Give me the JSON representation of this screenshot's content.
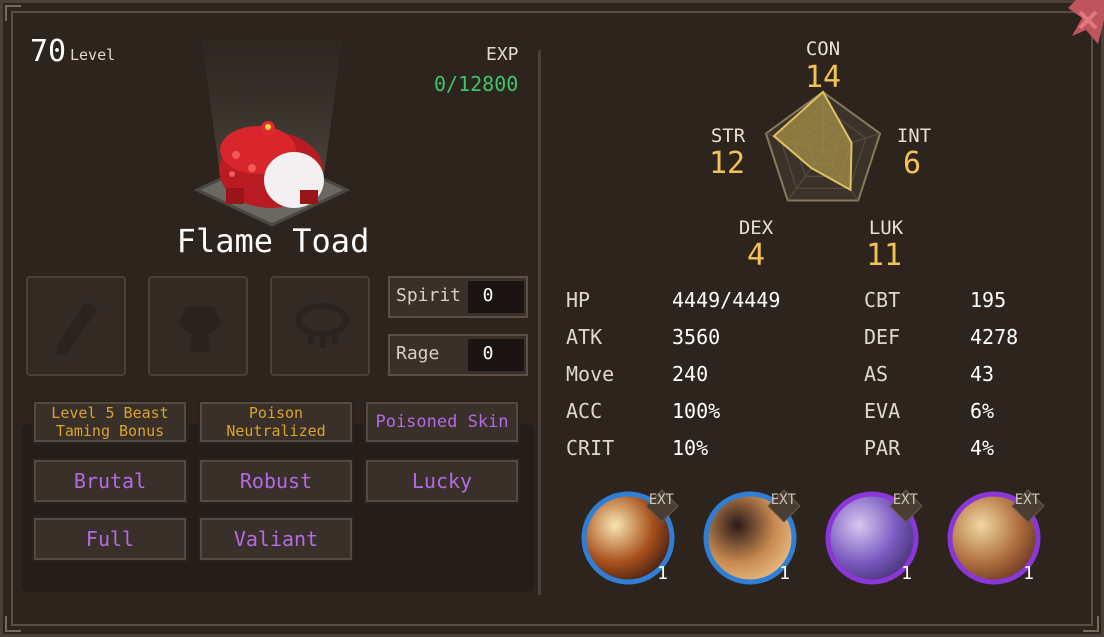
{
  "level": {
    "value": "70",
    "label": "Level"
  },
  "exp": {
    "label": "EXP",
    "value": "0/12800"
  },
  "pet": {
    "name": "Flame Toad"
  },
  "gauges": [
    {
      "label": "Spirit",
      "value": "0"
    },
    {
      "label": "Rage",
      "value": "0"
    }
  ],
  "equipment": [
    "weapon-slot",
    "armor-slot",
    "necklace-slot"
  ],
  "traits": {
    "special": [
      "Level 5 Beast",
      "Taming Bonus",
      "Poison",
      "Neutralized",
      "Poisoned Skin"
    ],
    "rows": [
      "Brutal",
      "Robust",
      "Lucky",
      "Full",
      "Valiant"
    ]
  },
  "radar": {
    "CON": {
      "label": "CON",
      "value": "14"
    },
    "STR": {
      "label": "STR",
      "value": "12"
    },
    "INT": {
      "label": "INT",
      "value": "6"
    },
    "DEX": {
      "label": "DEX",
      "value": "4"
    },
    "LUK": {
      "label": "LUK",
      "value": "11"
    },
    "fill_fractions": {
      "CON": 1.0,
      "INT": 0.5,
      "LUK": 0.78,
      "DEX": 0.33,
      "STR": 0.86
    }
  },
  "stats": {
    "left": [
      {
        "name": "HP",
        "value": "4449/4449"
      },
      {
        "name": "ATK",
        "value": "3560"
      },
      {
        "name": "Move",
        "value": "240"
      },
      {
        "name": "ACC",
        "value": "100%"
      },
      {
        "name": "CRIT",
        "value": "10%"
      }
    ],
    "right": [
      {
        "name": "CBT",
        "value": "195"
      },
      {
        "name": "DEF",
        "value": "4278"
      },
      {
        "name": "AS",
        "value": "43"
      },
      {
        "name": "EVA",
        "value": "6%"
      },
      {
        "name": "PAR",
        "value": "4%"
      }
    ]
  },
  "skills": [
    {
      "tag": "EXT",
      "level": "1",
      "ring_color": "#2f7fd6"
    },
    {
      "tag": "EXT",
      "level": "1",
      "ring_color": "#2f7fd6"
    },
    {
      "tag": "EXT",
      "level": "1",
      "ring_color": "#8a36d8"
    },
    {
      "tag": "EXT",
      "level": "1",
      "ring_color": "#8a36d8"
    }
  ],
  "colors": {
    "exp_green": "#3fc36a",
    "stat_gold": "#f2c255",
    "trait_gold": "#d9a32c",
    "trait_purple": "#b46ae6"
  }
}
